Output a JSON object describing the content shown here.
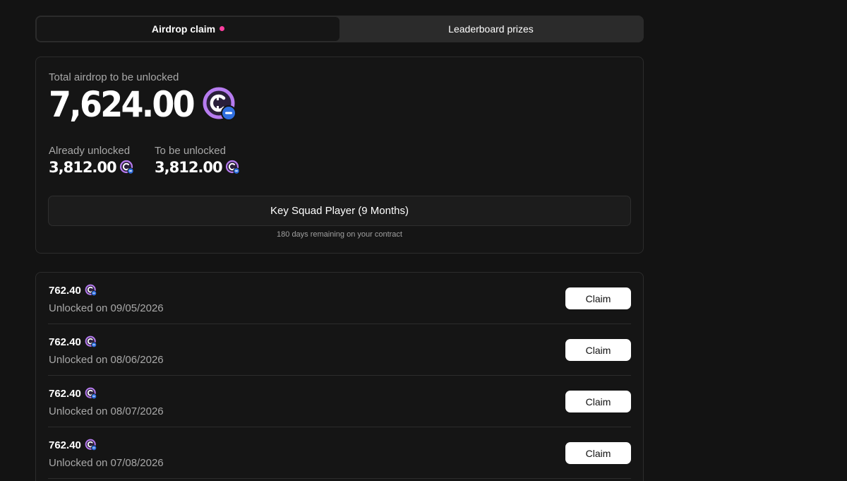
{
  "tabs": {
    "airdrop_claim": "Airdrop claim",
    "leaderboard_prizes": "Leaderboard prizes"
  },
  "summary": {
    "total_label": "Total airdrop to be unlocked",
    "total_amount": "7,624.00",
    "already_unlocked_label": "Already unlocked",
    "already_unlocked_amount": "3,812.00",
    "to_be_unlocked_label": "To be unlocked",
    "to_be_unlocked_amount": "3,812.00",
    "plan": "Key Squad Player (9 Months)",
    "remaining": "180 days remaining on your contract"
  },
  "unlocks": [
    {
      "amount": "762.40",
      "date": "Unlocked on 09/05/2026",
      "action": "Claim"
    },
    {
      "amount": "762.40",
      "date": "Unlocked on 08/06/2026",
      "action": "Claim"
    },
    {
      "amount": "762.40",
      "date": "Unlocked on 08/07/2026",
      "action": "Claim"
    },
    {
      "amount": "762.40",
      "date": "Unlocked on 07/08/2026",
      "action": "Claim"
    }
  ],
  "colors": {
    "background": "#131313",
    "accent_dot": "#ff3fa0",
    "coin_ring": "#b77cf0",
    "coin_badge": "#2f6fe0"
  },
  "icons": {
    "token": "token-coin-icon",
    "notification": "notification-dot"
  }
}
